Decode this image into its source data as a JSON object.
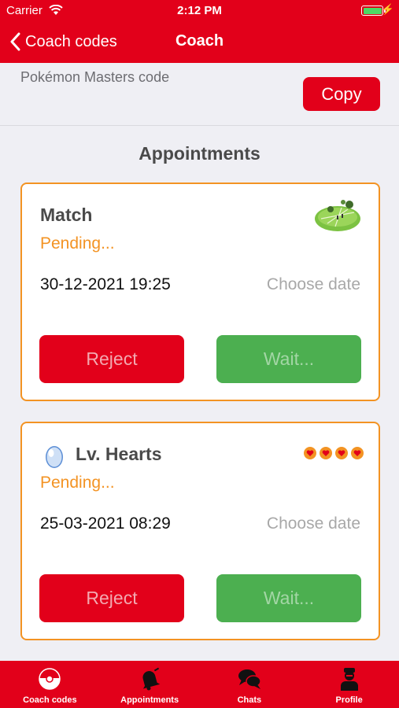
{
  "status_bar": {
    "carrier": "Carrier",
    "time": "2:12 PM"
  },
  "nav": {
    "back_label": "Coach codes",
    "title": "Coach"
  },
  "code_section": {
    "label": "Pokémon Masters code",
    "copy_label": "Copy"
  },
  "appointments": {
    "title": "Appointments",
    "cards": [
      {
        "name": "Match",
        "status": "Pending...",
        "datetime": "30-12-2021 19:25",
        "choose_date": "Choose date",
        "reject_label": "Reject",
        "wait_label": "Wait...",
        "icon": "field-icon"
      },
      {
        "name": "Lv. Hearts",
        "status": "Pending...",
        "datetime": "25-03-2021 08:29",
        "choose_date": "Choose date",
        "reject_label": "Reject",
        "wait_label": "Wait...",
        "icon": "egg-icon",
        "hearts": 4
      }
    ]
  },
  "tabs": [
    {
      "label": "Coach codes",
      "icon": "pokeball-icon"
    },
    {
      "label": "Appointments",
      "icon": "bell-icon"
    },
    {
      "label": "Chats",
      "icon": "chat-icon"
    },
    {
      "label": "Profile",
      "icon": "profile-icon"
    }
  ],
  "colors": {
    "brand_red": "#e2001a",
    "pending_orange": "#f39323",
    "wait_green": "#4caf50",
    "background": "#efeff4"
  }
}
